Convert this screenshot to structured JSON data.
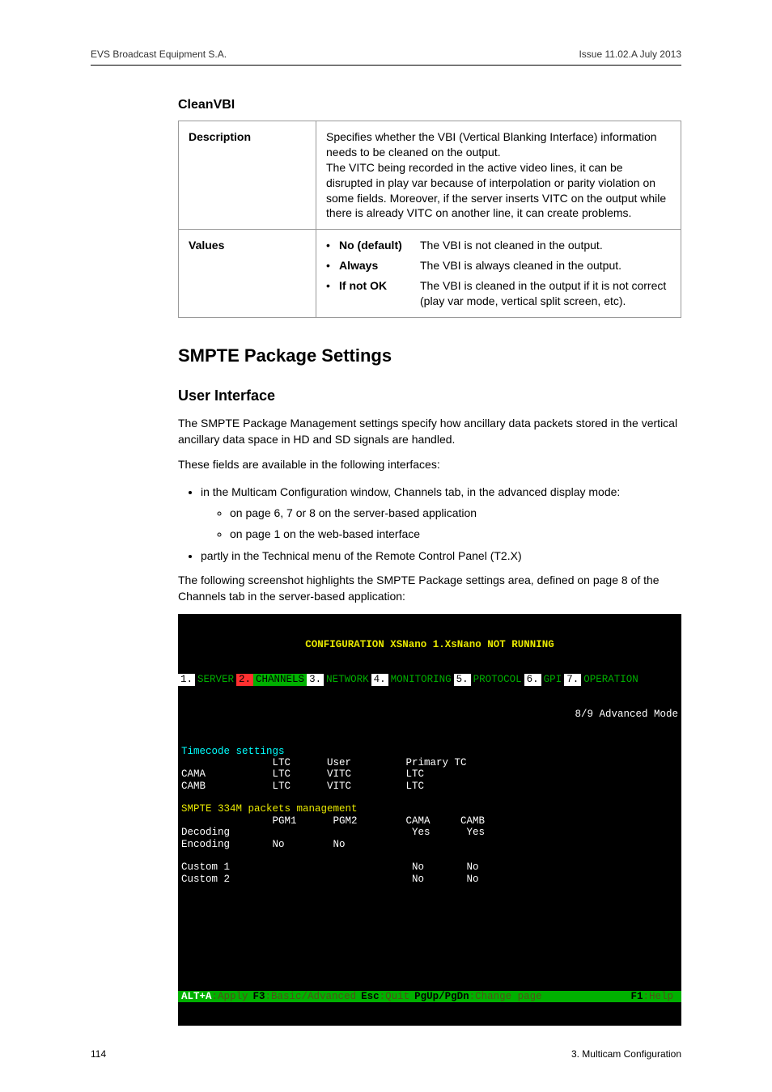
{
  "header": {
    "left": "EVS Broadcast Equipment S.A.",
    "right": "Issue 11.02.A  July 2013"
  },
  "cleanvbi": {
    "title": "CleanVBI",
    "rows": {
      "descriptionLabel": "Description",
      "descriptionText": "Specifies whether the VBI (Vertical Blanking Interface) information needs to be cleaned on the output.\nThe VITC being recorded in the active video lines, it can be disrupted in play var because of interpolation or parity violation on some fields. Moreover, if the server inserts VITC on the output while there is already VITC on another line, it can create problems.",
      "valuesLabel": "Values",
      "values": [
        {
          "name": "No (default)",
          "desc": "The VBI is not cleaned in the output."
        },
        {
          "name": "Always",
          "desc": "The VBI is always cleaned in the output."
        },
        {
          "name": "If not OK",
          "desc": "The VBI is cleaned in the output if it is not correct (play var mode, vertical split screen, etc)."
        }
      ]
    }
  },
  "smpte": {
    "heading": "SMPTE Package Settings",
    "subheading": "User Interface",
    "p1": "The SMPTE Package Management settings specify how ancillary data packets stored in the vertical ancillary data space in HD and SD signals are handled.",
    "p2": "These fields are available in the following interfaces:",
    "bullets": {
      "b1": "in the Multicam Configuration window, Channels tab, in the advanced display mode:",
      "b1a": "on page 6, 7 or 8 on the server-based application",
      "b1b": "on page 1 on the web-based interface",
      "b2": "partly in the Technical menu of the Remote Control Panel (T2.X)"
    },
    "p3": "The following screenshot highlights the SMPTE Package settings area, defined on page 8 of the Channels tab in the server-based application:"
  },
  "terminal": {
    "title": "CONFIGURATION XSNano 1.XsNano NOT RUNNING",
    "tabs": [
      {
        "num": "1",
        "name": "SERVER",
        "selected": false
      },
      {
        "num": "2",
        "name": "CHANNELS",
        "selected": true
      },
      {
        "num": "3",
        "name": "NETWORK",
        "selected": false
      },
      {
        "num": "4",
        "name": "MONITORING",
        "selected": false
      },
      {
        "num": "5",
        "name": "PROTOCOL",
        "selected": false
      },
      {
        "num": "6",
        "name": "GPI",
        "selected": false
      },
      {
        "num": "7",
        "name": "OPERATION",
        "selected": false
      }
    ],
    "mode": "8/9 Advanced Mode",
    "timecode": {
      "heading": "Timecode settings",
      "hdr": "               LTC      User         Primary TC",
      "rows": [
        "CAMA           LTC      VITC         LTC",
        "CAMB           LTC      VITC         LTC"
      ]
    },
    "smpteSection": {
      "heading": "SMPTE 334M packets management",
      "hdr": "               PGM1      PGM2        CAMA     CAMB",
      "rows": [
        "Decoding                              Yes      Yes",
        "Encoding       No        No",
        "",
        "Custom 1                              No       No",
        "Custom 2                              No       No"
      ]
    },
    "footer": {
      "items": [
        {
          "key": "ALT+A",
          "desc": ":Apply"
        },
        {
          "key": "F3",
          "desc": ":Basic/Advanced"
        },
        {
          "key": "Esc",
          "desc": ":Quit"
        },
        {
          "key": "PgUp/PgDn",
          "desc": ":Change page"
        }
      ],
      "help": {
        "key": "F1",
        "desc": ":Help"
      }
    }
  },
  "footer": {
    "pageNum": "114",
    "section": "3. Multicam Configuration"
  }
}
